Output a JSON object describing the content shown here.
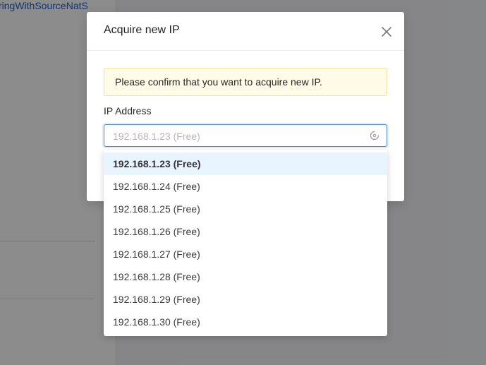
{
  "background": {
    "link_text": "ringWithSourceNatS"
  },
  "modal": {
    "title": "Acquire new IP",
    "close_icon": "close-icon",
    "alert_text": "Please confirm that you want to acquire new IP.",
    "field_label": "IP Address",
    "select": {
      "value": "192.168.1.23 (Free)",
      "icon": "loading-icon"
    }
  },
  "dropdown": {
    "options": [
      "192.168.1.23 (Free)",
      "192.168.1.24 (Free)",
      "192.168.1.25 (Free)",
      "192.168.1.26 (Free)",
      "192.168.1.27 (Free)",
      "192.168.1.28 (Free)",
      "192.168.1.29 (Free)",
      "192.168.1.30 (Free)"
    ],
    "active_index": 0
  },
  "colors": {
    "accent": "#4d8ad8",
    "alert_bg": "#fffbe6",
    "active_option_bg": "#e8f4ff"
  }
}
